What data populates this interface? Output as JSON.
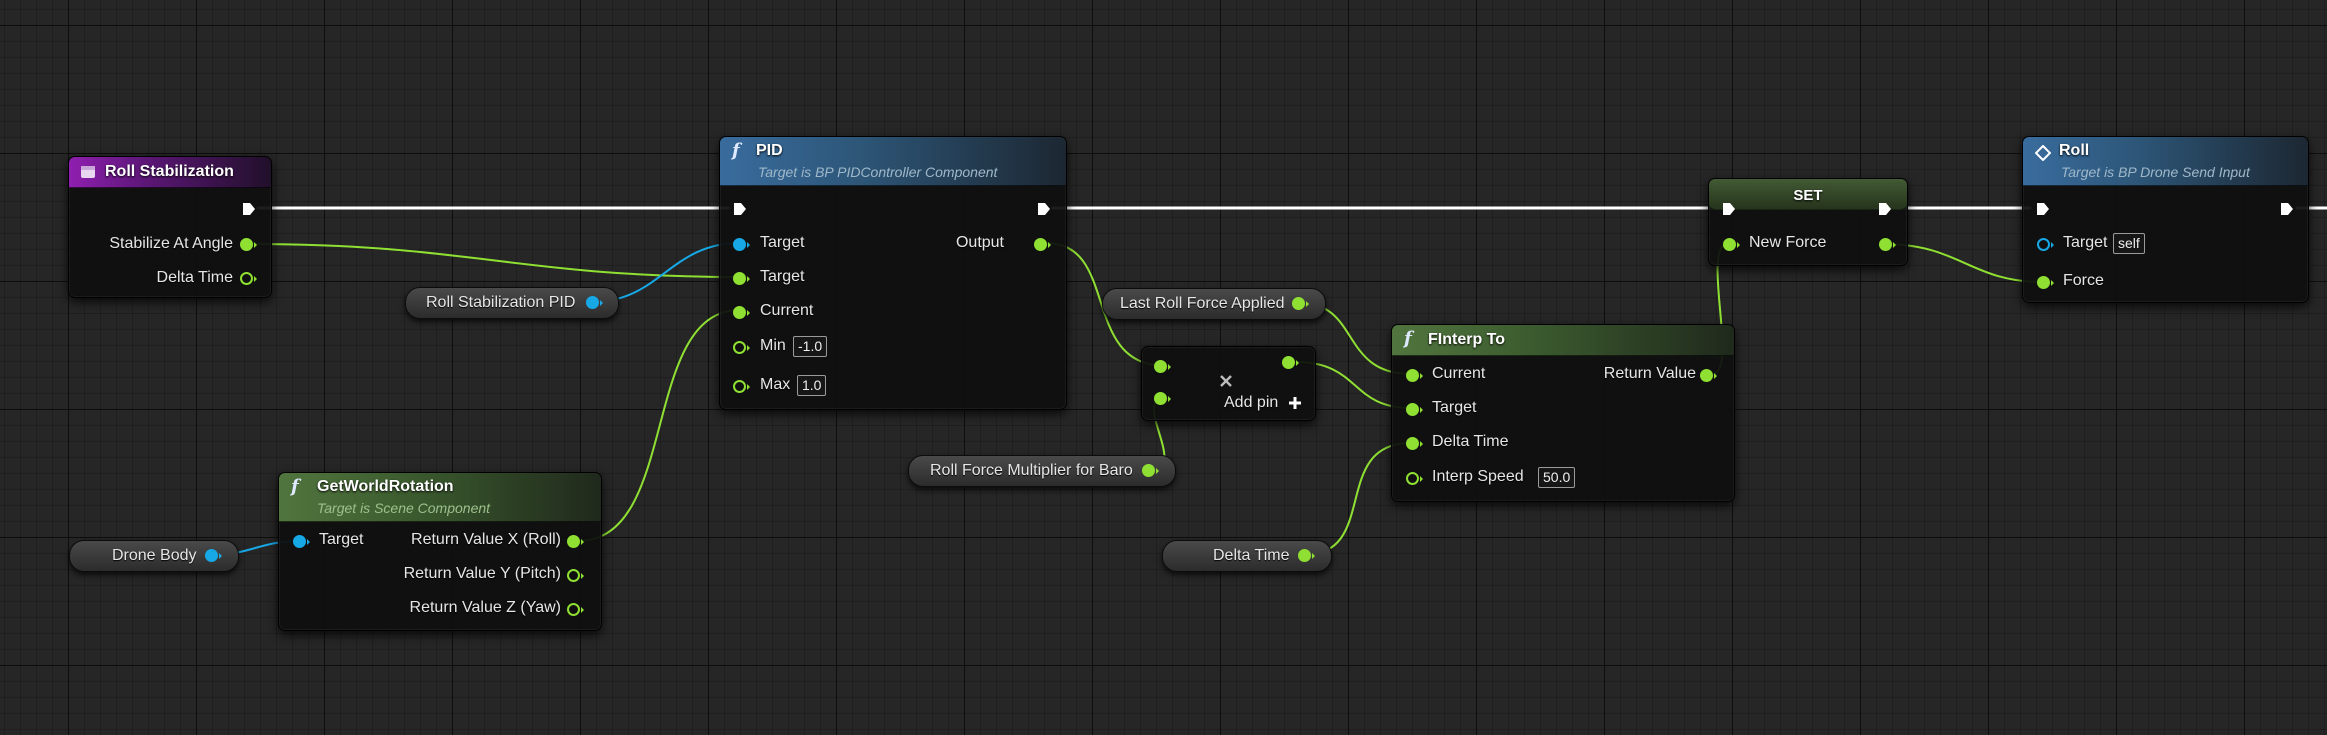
{
  "nodes": {
    "roll_stabilization": {
      "title": "Roll Stabilization",
      "outputs": [
        "Stabilize At Angle",
        "Delta Time"
      ]
    },
    "pid": {
      "title": "PID",
      "subtitle": "Target is BP PIDController Component",
      "inputs": [
        "Target",
        "Target",
        "Current",
        "Min",
        "Max"
      ],
      "min_value": "-1.0",
      "max_value": "1.0",
      "output": "Output"
    },
    "get_world_rotation": {
      "title": "GetWorldRotation",
      "subtitle": "Target is Scene Component",
      "input": "Target",
      "outputs": [
        "Return Value X (Roll)",
        "Return Value Y (Pitch)",
        "Return Value Z (Yaw)"
      ]
    },
    "add": {
      "add_pin_label": "Add pin"
    },
    "finterp": {
      "title": "FInterp To",
      "inputs": [
        "Current",
        "Target",
        "Delta Time",
        "Interp Speed"
      ],
      "interp_speed_value": "50.0",
      "output": "Return Value"
    },
    "set": {
      "title": "SET",
      "input": "New Force"
    },
    "roll": {
      "title": "Roll",
      "subtitle": "Target is BP Drone Send Input",
      "inputs": [
        "Target",
        "Force"
      ],
      "target_value": "self"
    }
  },
  "variables": {
    "roll_stabilization_pid": "Roll Stabilization PID",
    "drone_body": "Drone Body",
    "last_roll_force_applied": "Last Roll Force Applied",
    "roll_force_multiplier": "Roll Force Multiplier for Baro",
    "delta_time": "Delta Time"
  },
  "colors": {
    "exec_wire": "#ffffff",
    "float_pin": "#8fe033",
    "object_pin": "#17a8e6",
    "event_header": "#8f1fb0",
    "function_header": "#396c9e",
    "pure_header": "#51753e"
  }
}
